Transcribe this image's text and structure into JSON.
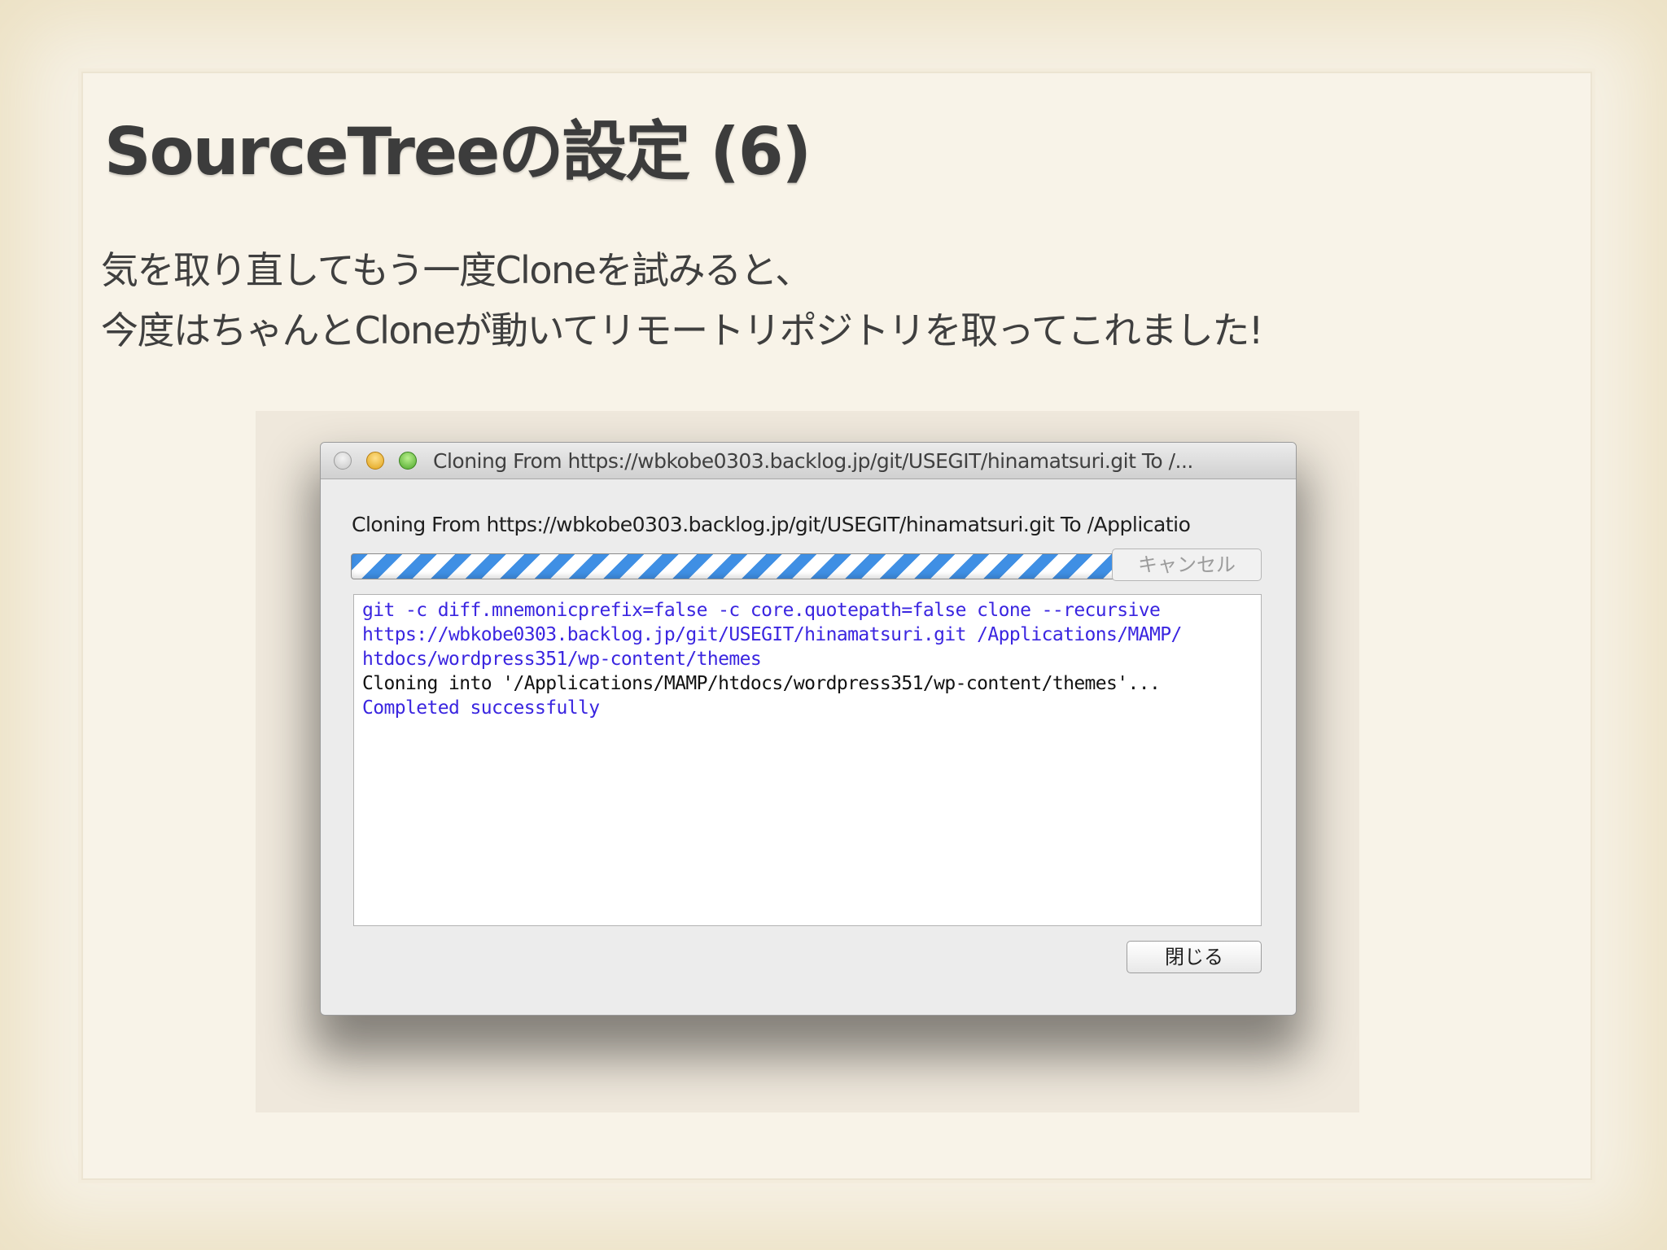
{
  "slide": {
    "title": "SourceTreeの設定 (6)",
    "lines": [
      "気を取り直してもう一度Cloneを試みると、",
      "今度はちゃんとCloneが動いてリモートリポジトリを取ってこれました!"
    ]
  },
  "window": {
    "title": "Cloning From https://wbkobe0303.backlog.jp/git/USEGIT/hinamatsuri.git To /...",
    "status": "Cloning From https://wbkobe0303.backlog.jp/git/USEGIT/hinamatsuri.git To /Applicatio",
    "cancel_label": "キャンセル",
    "close_label": "閉じる",
    "log": [
      {
        "text": "git -c diff.mnemonicprefix=false -c core.quotepath=false clone --recursive",
        "kind": "cmd"
      },
      {
        "text": "https://wbkobe0303.backlog.jp/git/USEGIT/hinamatsuri.git /Applications/MAMP/",
        "kind": "cmd"
      },
      {
        "text": "htdocs/wordpress351/wp-content/themes",
        "kind": "cmd"
      },
      {
        "text": "Cloning into '/Applications/MAMP/htdocs/wordpress351/wp-content/themes'...",
        "kind": "out"
      },
      {
        "text": "Completed successfully",
        "kind": "cmd"
      }
    ],
    "colors": {
      "command_text": "#3a25e0",
      "output_text": "#111111",
      "progress_stripe": "#3f8fe4"
    }
  }
}
